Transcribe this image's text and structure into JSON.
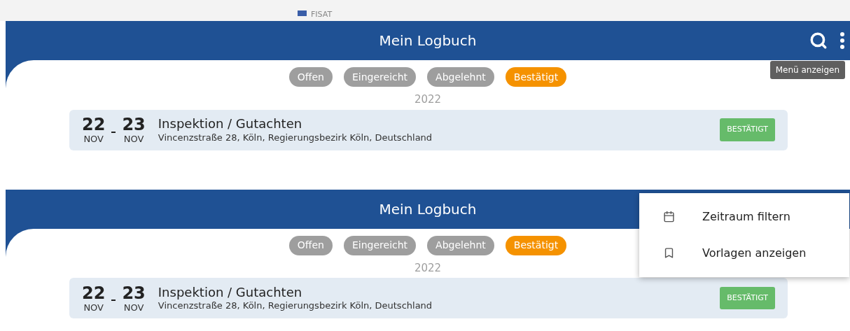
{
  "panels": [
    {
      "top_strip": {
        "label": "FISAT"
      },
      "title": "Mein Logbuch",
      "actions": [
        {
          "kind": "search"
        },
        {
          "kind": "more"
        }
      ],
      "tooltip": "Menü anzeigen",
      "filters": [
        {
          "label": "Offen",
          "selected": false
        },
        {
          "label": "Eingereicht",
          "selected": false
        },
        {
          "label": "Abgelehnt",
          "selected": false
        },
        {
          "label": "Bestätigt",
          "selected": true
        }
      ],
      "year": "2022",
      "entries": [
        {
          "start_day": "22",
          "start_month": "NOV",
          "end_day": "23",
          "end_month": "NOV",
          "title": "Inspektion / Gutachten",
          "address": "Vincenzstraße 28, Köln, Regierungsbezirk Köln, Deutschland",
          "status": "BESTÄTIGT"
        }
      ]
    },
    {
      "title": "Mein Logbuch",
      "menu": [
        {
          "kind": "calendar",
          "label": "Zeitraum filtern"
        },
        {
          "kind": "bookmark",
          "label": "Vorlagen anzeigen"
        }
      ],
      "filters": [
        {
          "label": "Offen",
          "selected": false
        },
        {
          "label": "Eingereicht",
          "selected": false
        },
        {
          "label": "Abgelehnt",
          "selected": false
        },
        {
          "label": "Bestätigt",
          "selected": true
        }
      ],
      "year": "2022",
      "entries": [
        {
          "start_day": "22",
          "start_month": "NOV",
          "end_day": "23",
          "end_month": "NOV",
          "title": "Inspektion / Gutachten",
          "address": "Vincenzstraße 28, Köln, Regierungsbezirk Köln, Deutschland",
          "status": "BESTÄTIGT"
        }
      ]
    }
  ]
}
